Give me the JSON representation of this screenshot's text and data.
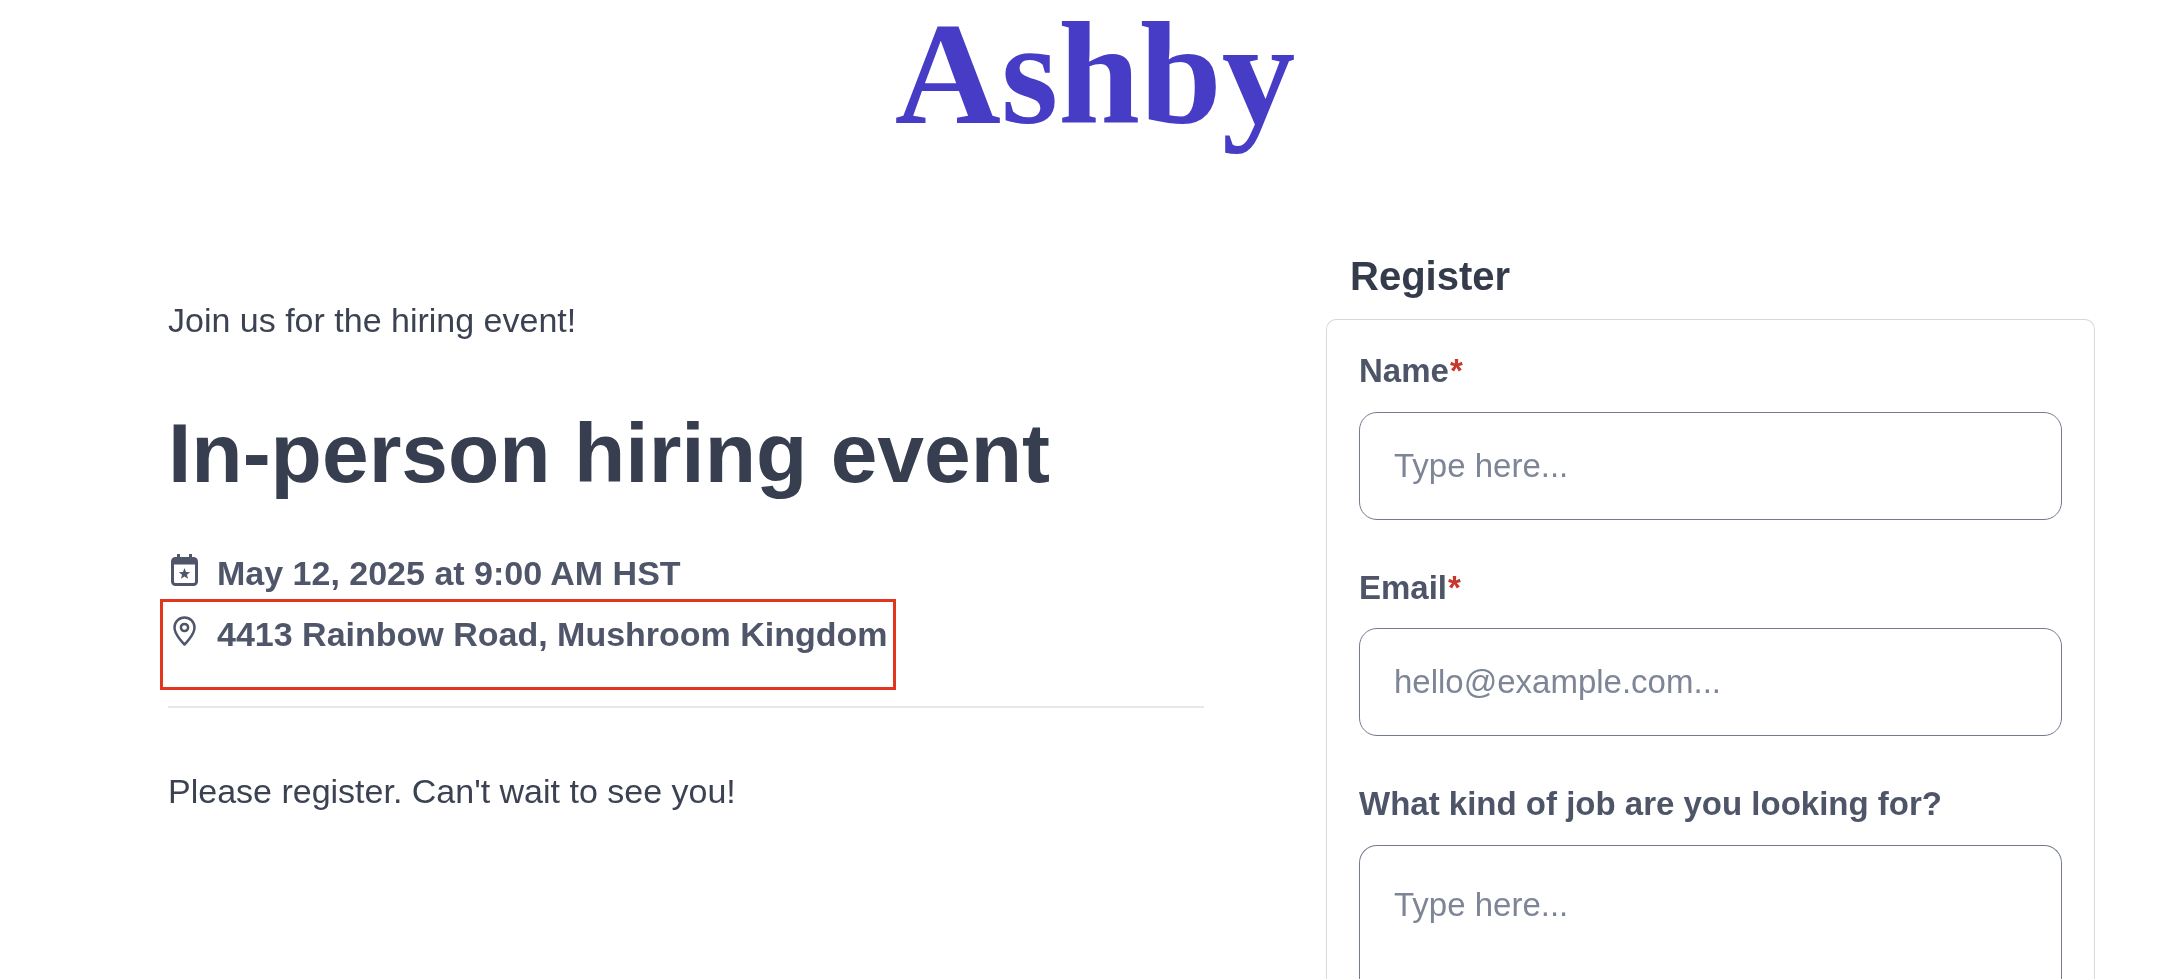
{
  "logo": {
    "text": "Ashby"
  },
  "event": {
    "intro": "Join us for the hiring event!",
    "title": "In-person hiring event",
    "details": [
      {
        "kind": "date",
        "text": "May 12, 2025 at 9:00 AM HST",
        "highlighted": false
      },
      {
        "kind": "location",
        "text": "4413 Rainbow Road, Mushroom Kingdom",
        "highlighted": true
      }
    ],
    "message": "Please register. Can't wait to see you!"
  },
  "register": {
    "heading": "Register",
    "fields": [
      {
        "kind": "input",
        "label": "Name",
        "required_mark": "*",
        "placeholder": "Type here..."
      },
      {
        "kind": "input",
        "label": "Email",
        "required_mark": "*",
        "placeholder": "hello@example.com..."
      },
      {
        "kind": "textarea",
        "label": "What kind of job are you looking for?",
        "placeholder": "Type here..."
      }
    ]
  }
}
